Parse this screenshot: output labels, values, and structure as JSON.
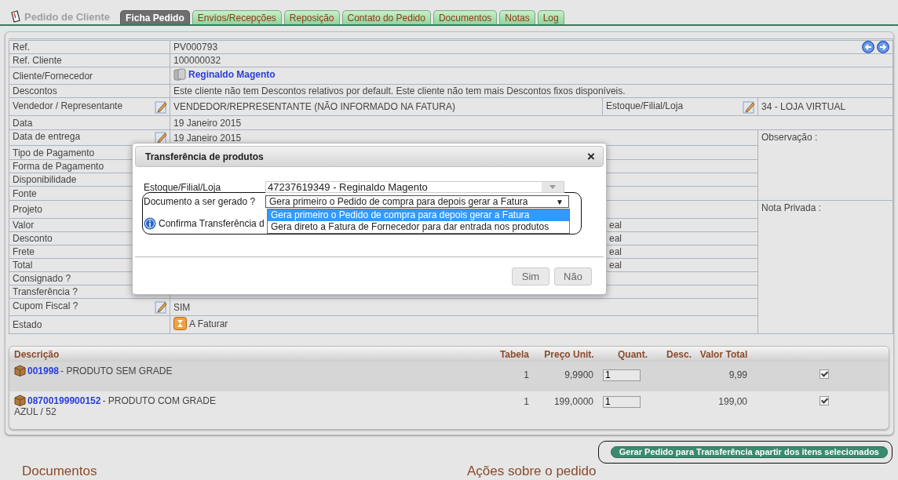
{
  "header": {
    "title": "Pedido de Cliente"
  },
  "tabs": [
    {
      "label": "Ficha Pedido",
      "selected": true
    },
    {
      "label": "Envíos/Recepções",
      "selected": false
    },
    {
      "label": "Reposição",
      "selected": false
    },
    {
      "label": "Contato do Pedido",
      "selected": false
    },
    {
      "label": "Documentos",
      "selected": false
    },
    {
      "label": "Notas",
      "selected": false
    },
    {
      "label": "Log",
      "selected": false
    }
  ],
  "fields": [
    {
      "label": "Ref.",
      "kind": "nav",
      "value": "PV000793",
      "editable": false
    },
    {
      "label": "Ref. Cliente",
      "kind": "text",
      "value": "100000032",
      "editable": false
    },
    {
      "label": "Cliente/Fornecedor",
      "kind": "link",
      "value": "Reginaldo Magento",
      "editable": false
    },
    {
      "label": "Descontos",
      "kind": "text",
      "value": "Este cliente não tem Descontos relativos por default. Este cliente não tem mais Descontos fixos disponíveis.",
      "editable": false
    },
    {
      "label": "Vendedor / Representante",
      "kind": "split",
      "value": "VENDEDOR/REPRESENTANTE (NÃO INFORMADO NA FATURA)",
      "editable": true,
      "label_2": "Estoque/Filial/Loja",
      "value_2": "34 - LOJA VIRTUAL"
    },
    {
      "label": "Data",
      "kind": "text",
      "value": "19 Janeiro 2015",
      "editable": false
    },
    {
      "label": "Data de entrega",
      "kind": "text",
      "value": "19 Janeiro 2015",
      "editable": true,
      "note": "Observação :"
    },
    {
      "label": "Tipo de Pagamento",
      "kind": "text",
      "editable": false
    },
    {
      "label": "Forma de Pagamento",
      "kind": "text",
      "editable": false
    },
    {
      "label": "Disponibilidade",
      "kind": "text",
      "editable": false
    },
    {
      "label": "Fonte",
      "kind": "text",
      "editable": false
    },
    {
      "label": "Projeto",
      "kind": "text",
      "editable": false,
      "note": "Nota Privada :"
    },
    {
      "label": "Valor",
      "kind": "covered",
      "value": "eal",
      "editable": false
    },
    {
      "label": "Desconto",
      "kind": "covered",
      "value": "eal",
      "editable": false
    },
    {
      "label": "Frete",
      "kind": "covered",
      "value": "eal",
      "editable": false
    },
    {
      "label": "Total",
      "kind": "covered",
      "value": "eal",
      "editable": false
    },
    {
      "label": "Consignado ?",
      "kind": "text",
      "editable": false
    },
    {
      "label": "Transferência ?",
      "kind": "text",
      "editable": false
    },
    {
      "label": "Cupom Fiscal ?",
      "kind": "text",
      "value": "SIM",
      "editable": true
    },
    {
      "label": "Estado",
      "kind": "status",
      "value": "A Faturar",
      "editable": false
    }
  ],
  "products": {
    "columns": [
      "Descrição",
      "Tabela",
      "Preço Unit.",
      "Quant.",
      "Desc.",
      "Valor Total"
    ],
    "rows": [
      {
        "code": "001998",
        "name": " - PRODUTO SEM GRADE",
        "tabela": "1",
        "preco": "9,9900",
        "quant": "1",
        "total": "9,99",
        "checked": true
      },
      {
        "code": "08700199900152",
        "name": " - PRODUTO COM GRADE",
        "variant": "AZUL / 52",
        "tabela": "1",
        "preco": "199,0000",
        "quant": "1",
        "total": "199,00",
        "checked": true
      }
    ]
  },
  "action_button": "Gerar Pedido para Transferência apartir dos itens selecionados",
  "sections": [
    "Documentos",
    "Ações sobre o pedido"
  ],
  "modal": {
    "title": "Transferência de produtos",
    "close": "×",
    "stock_label": "Estoque/Filial/Loja",
    "stock_value": "47237619349 - Reginaldo Magento",
    "doc_label": "Documento a ser gerado ?",
    "doc_value": "Gera primeiro o Pedido de compra para depois gerar a Fatura",
    "doc_caret": "▼",
    "options": [
      {
        "label": "Gera primeiro o Pedido de compra para depois gerar a Fatura",
        "selected": true
      },
      {
        "label": "Gera direto a Fatura de Fornecedor para dar entrada nos produtos",
        "selected": false
      }
    ],
    "info": "Confirma Transferência d",
    "buttons": [
      "Sim",
      "Não"
    ]
  }
}
